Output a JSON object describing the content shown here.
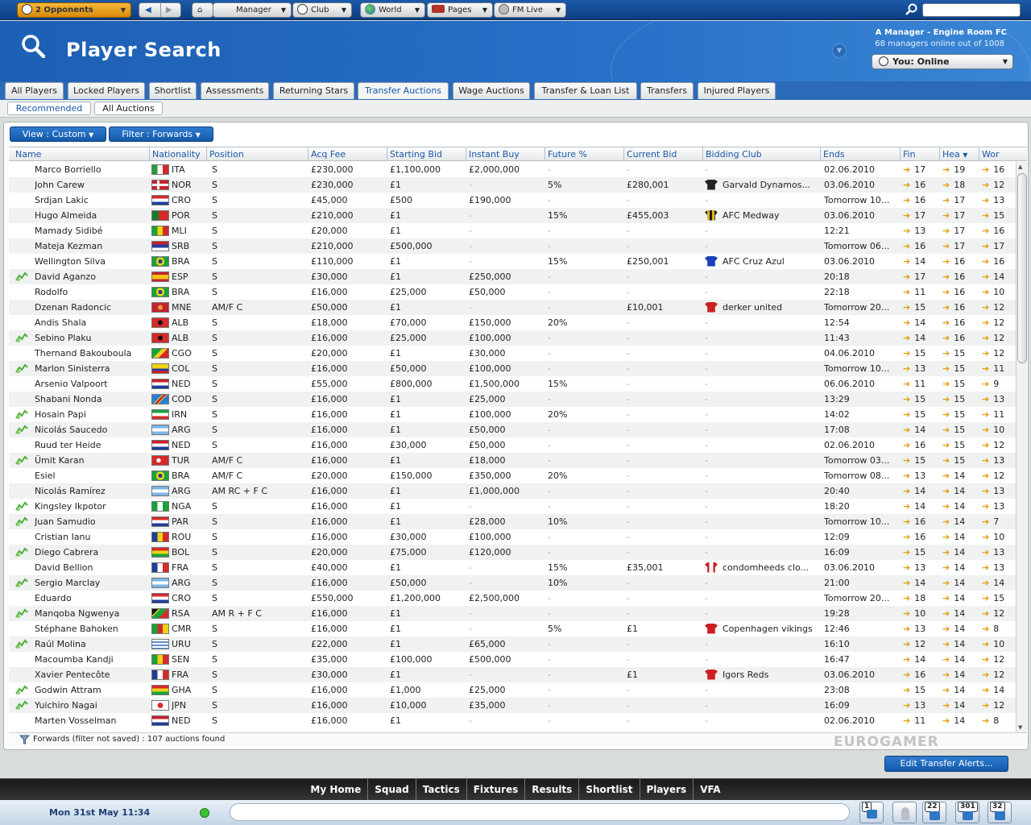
{
  "topbar": {
    "opponents": "2 Opponents",
    "manager": "Manager",
    "club": "Club",
    "world": "World",
    "pages": "Pages",
    "fm_live": "FM Live"
  },
  "header": {
    "title": "Player Search",
    "manager_name": "A Manager - Engine Room FC",
    "managers_online": "68 managers online out of 1008",
    "status": "You: Online"
  },
  "tabs": [
    "All Players",
    "Locked Players",
    "Shortlist",
    "Assessments",
    "Returning Stars",
    "Transfer Auctions",
    "Wage Auctions",
    "Transfer & Loan List",
    "Transfers",
    "Injured Players"
  ],
  "subtabs": [
    "Recommended",
    "All Auctions"
  ],
  "view_button": "View : Custom",
  "filter_button": "Filter : Forwards",
  "columns": [
    "Name",
    "Nationality",
    "Position",
    "Acq Fee",
    "Starting Bid",
    "Instant Buy",
    "Future %",
    "Current Bid",
    "Bidding Club",
    "Ends",
    "Fin",
    "Hea",
    "Wor"
  ],
  "players": [
    {
      "name": "Marco Borriello",
      "nat": "ITA",
      "pos": "S",
      "acq": "£230,000",
      "start": "£1,100,000",
      "buy": "£2,000,000",
      "fut": "-",
      "bid": "-",
      "club": "-",
      "ends": "02.06.2010",
      "fin": "17",
      "hea": "19",
      "wor": "16",
      "star": false,
      "flag": "ita",
      "shirt": ""
    },
    {
      "name": "John Carew",
      "nat": "NOR",
      "pos": "S",
      "acq": "£230,000",
      "start": "£1",
      "buy": "-",
      "fut": "5%",
      "bid": "£280,001",
      "club": "Garvald Dynamos...",
      "ends": "03.06.2010",
      "fin": "16",
      "hea": "18",
      "wor": "12",
      "star": false,
      "flag": "nor",
      "shirt": "black"
    },
    {
      "name": "Srdjan Lakic",
      "nat": "CRO",
      "pos": "S",
      "acq": "£45,000",
      "start": "£500",
      "buy": "£190,000",
      "fut": "-",
      "bid": "-",
      "club": "-",
      "ends": "Tomorrow 10...",
      "fin": "16",
      "hea": "17",
      "wor": "13",
      "star": false,
      "flag": "cro",
      "shirt": ""
    },
    {
      "name": "Hugo Almeida",
      "nat": "POR",
      "pos": "S",
      "acq": "£210,000",
      "start": "£1",
      "buy": "-",
      "fut": "15%",
      "bid": "£455,003",
      "club": "AFC Medway",
      "ends": "03.06.2010",
      "fin": "17",
      "hea": "17",
      "wor": "15",
      "star": false,
      "flag": "por",
      "shirt": "stripe"
    },
    {
      "name": "Mamady Sidibé",
      "nat": "MLI",
      "pos": "S",
      "acq": "£20,000",
      "start": "£1",
      "buy": "-",
      "fut": "-",
      "bid": "-",
      "club": "-",
      "ends": "12:21",
      "fin": "13",
      "hea": "17",
      "wor": "16",
      "star": false,
      "flag": "mli",
      "shirt": ""
    },
    {
      "name": "Mateja Kezman",
      "nat": "SRB",
      "pos": "S",
      "acq": "£210,000",
      "start": "£500,000",
      "buy": "-",
      "fut": "-",
      "bid": "-",
      "club": "-",
      "ends": "Tomorrow 06...",
      "fin": "16",
      "hea": "17",
      "wor": "17",
      "star": false,
      "flag": "srb",
      "shirt": ""
    },
    {
      "name": "Wellington Silva",
      "nat": "BRA",
      "pos": "S",
      "acq": "£110,000",
      "start": "£1",
      "buy": "-",
      "fut": "15%",
      "bid": "£250,001",
      "club": "AFC Cruz Azul",
      "ends": "03.06.2010",
      "fin": "14",
      "hea": "16",
      "wor": "16",
      "star": false,
      "flag": "bra",
      "shirt": "blue"
    },
    {
      "name": "David Aganzo",
      "nat": "ESP",
      "pos": "S",
      "acq": "£30,000",
      "start": "£1",
      "buy": "£250,000",
      "fut": "-",
      "bid": "-",
      "club": "-",
      "ends": "20:18",
      "fin": "17",
      "hea": "16",
      "wor": "14",
      "star": true,
      "flag": "esp",
      "shirt": ""
    },
    {
      "name": "Rodolfo",
      "nat": "BRA",
      "pos": "S",
      "acq": "£16,000",
      "start": "£25,000",
      "buy": "£50,000",
      "fut": "-",
      "bid": "-",
      "club": "-",
      "ends": "22:18",
      "fin": "11",
      "hea": "16",
      "wor": "10",
      "star": false,
      "flag": "bra",
      "shirt": ""
    },
    {
      "name": "Dzenan Radoncic",
      "nat": "MNE",
      "pos": "AM/F C",
      "acq": "£50,000",
      "start": "£1",
      "buy": "-",
      "fut": "-",
      "bid": "£10,001",
      "club": "derker united",
      "ends": "Tomorrow 20...",
      "fin": "15",
      "hea": "16",
      "wor": "12",
      "star": false,
      "flag": "mne",
      "shirt": "red"
    },
    {
      "name": "Andis Shala",
      "nat": "ALB",
      "pos": "S",
      "acq": "£18,000",
      "start": "£70,000",
      "buy": "£150,000",
      "fut": "20%",
      "bid": "-",
      "club": "-",
      "ends": "12:54",
      "fin": "14",
      "hea": "16",
      "wor": "12",
      "star": false,
      "flag": "alb",
      "shirt": ""
    },
    {
      "name": "Sebino Plaku",
      "nat": "ALB",
      "pos": "S",
      "acq": "£16,000",
      "start": "£25,000",
      "buy": "£100,000",
      "fut": "-",
      "bid": "-",
      "club": "-",
      "ends": "11:43",
      "fin": "14",
      "hea": "16",
      "wor": "12",
      "star": true,
      "flag": "alb",
      "shirt": ""
    },
    {
      "name": "Thernand Bakouboula",
      "nat": "CGO",
      "pos": "S",
      "acq": "£20,000",
      "start": "£1",
      "buy": "£30,000",
      "fut": "-",
      "bid": "-",
      "club": "-",
      "ends": "04.06.2010",
      "fin": "15",
      "hea": "15",
      "wor": "12",
      "star": false,
      "flag": "cgo",
      "shirt": ""
    },
    {
      "name": "Marlon Sinisterra",
      "nat": "COL",
      "pos": "S",
      "acq": "£16,000",
      "start": "£50,000",
      "buy": "£100,000",
      "fut": "-",
      "bid": "-",
      "club": "-",
      "ends": "Tomorrow 10...",
      "fin": "13",
      "hea": "15",
      "wor": "11",
      "star": true,
      "flag": "col",
      "shirt": ""
    },
    {
      "name": "Arsenio Valpoort",
      "nat": "NED",
      "pos": "S",
      "acq": "£55,000",
      "start": "£800,000",
      "buy": "£1,500,000",
      "fut": "15%",
      "bid": "-",
      "club": "-",
      "ends": "06.06.2010",
      "fin": "11",
      "hea": "15",
      "wor": "9",
      "star": false,
      "flag": "ned",
      "shirt": ""
    },
    {
      "name": "Shabani Nonda",
      "nat": "COD",
      "pos": "S",
      "acq": "£16,000",
      "start": "£1",
      "buy": "£25,000",
      "fut": "-",
      "bid": "-",
      "club": "-",
      "ends": "13:29",
      "fin": "15",
      "hea": "15",
      "wor": "13",
      "star": false,
      "flag": "cod",
      "shirt": ""
    },
    {
      "name": "Hosain Papi",
      "nat": "IRN",
      "pos": "S",
      "acq": "£16,000",
      "start": "£1",
      "buy": "£100,000",
      "fut": "20%",
      "bid": "-",
      "club": "-",
      "ends": "14:02",
      "fin": "15",
      "hea": "15",
      "wor": "11",
      "star": true,
      "flag": "irn",
      "shirt": ""
    },
    {
      "name": "Nicolás Saucedo",
      "nat": "ARG",
      "pos": "S",
      "acq": "£16,000",
      "start": "£1",
      "buy": "£50,000",
      "fut": "-",
      "bid": "-",
      "club": "-",
      "ends": "17:08",
      "fin": "14",
      "hea": "15",
      "wor": "10",
      "star": true,
      "flag": "arg",
      "shirt": ""
    },
    {
      "name": "Ruud ter Heide",
      "nat": "NED",
      "pos": "S",
      "acq": "£16,000",
      "start": "£30,000",
      "buy": "£50,000",
      "fut": "-",
      "bid": "-",
      "club": "-",
      "ends": "02.06.2010",
      "fin": "16",
      "hea": "15",
      "wor": "12",
      "star": false,
      "flag": "ned",
      "shirt": ""
    },
    {
      "name": "Ümit Karan",
      "nat": "TUR",
      "pos": "AM/F C",
      "acq": "£16,000",
      "start": "£1",
      "buy": "£18,000",
      "fut": "-",
      "bid": "-",
      "club": "-",
      "ends": "Tomorrow 03...",
      "fin": "15",
      "hea": "15",
      "wor": "13",
      "star": true,
      "flag": "tur",
      "shirt": ""
    },
    {
      "name": "Esiel",
      "nat": "BRA",
      "pos": "AM/F C",
      "acq": "£20,000",
      "start": "£150,000",
      "buy": "£350,000",
      "fut": "20%",
      "bid": "-",
      "club": "-",
      "ends": "Tomorrow 08...",
      "fin": "13",
      "hea": "14",
      "wor": "12",
      "star": false,
      "flag": "bra",
      "shirt": ""
    },
    {
      "name": "Nicolás Ramírez",
      "nat": "ARG",
      "pos": "AM RC + F C",
      "acq": "£16,000",
      "start": "£1",
      "buy": "£1,000,000",
      "fut": "-",
      "bid": "-",
      "club": "-",
      "ends": "20:40",
      "fin": "14",
      "hea": "14",
      "wor": "13",
      "star": false,
      "flag": "arg",
      "shirt": ""
    },
    {
      "name": "Kingsley Ikpotor",
      "nat": "NGA",
      "pos": "S",
      "acq": "£16,000",
      "start": "£1",
      "buy": "-",
      "fut": "-",
      "bid": "-",
      "club": "-",
      "ends": "18:20",
      "fin": "14",
      "hea": "14",
      "wor": "13",
      "star": true,
      "flag": "nga",
      "shirt": ""
    },
    {
      "name": "Juan Samudio",
      "nat": "PAR",
      "pos": "S",
      "acq": "£16,000",
      "start": "£1",
      "buy": "£28,000",
      "fut": "10%",
      "bid": "-",
      "club": "-",
      "ends": "Tomorrow 10...",
      "fin": "16",
      "hea": "14",
      "wor": "7",
      "star": true,
      "flag": "par",
      "shirt": ""
    },
    {
      "name": "Cristian Ianu",
      "nat": "ROU",
      "pos": "S",
      "acq": "£16,000",
      "start": "£30,000",
      "buy": "£100,000",
      "fut": "-",
      "bid": "-",
      "club": "-",
      "ends": "12:09",
      "fin": "16",
      "hea": "14",
      "wor": "10",
      "star": false,
      "flag": "rou",
      "shirt": ""
    },
    {
      "name": "Diego Cabrera",
      "nat": "BOL",
      "pos": "S",
      "acq": "£20,000",
      "start": "£75,000",
      "buy": "£120,000",
      "fut": "-",
      "bid": "-",
      "club": "-",
      "ends": "16:09",
      "fin": "15",
      "hea": "14",
      "wor": "13",
      "star": true,
      "flag": "bol",
      "shirt": ""
    },
    {
      "name": "David Bellion",
      "nat": "FRA",
      "pos": "S",
      "acq": "£40,000",
      "start": "£1",
      "buy": "-",
      "fut": "15%",
      "bid": "£35,001",
      "club": "condomheeds clo...",
      "ends": "03.06.2010",
      "fin": "13",
      "hea": "14",
      "wor": "13",
      "star": false,
      "flag": "fra",
      "shirt": "redwhite"
    },
    {
      "name": "Sergio Marclay",
      "nat": "ARG",
      "pos": "S",
      "acq": "£16,000",
      "start": "£50,000",
      "buy": "-",
      "fut": "10%",
      "bid": "-",
      "club": "-",
      "ends": "21:00",
      "fin": "14",
      "hea": "14",
      "wor": "14",
      "star": true,
      "flag": "arg",
      "shirt": ""
    },
    {
      "name": "Eduardo",
      "nat": "CRO",
      "pos": "S",
      "acq": "£550,000",
      "start": "£1,200,000",
      "buy": "£2,500,000",
      "fut": "-",
      "bid": "-",
      "club": "-",
      "ends": "Tomorrow 20...",
      "fin": "18",
      "hea": "14",
      "wor": "15",
      "star": false,
      "flag": "cro",
      "shirt": ""
    },
    {
      "name": "Manqoba Ngwenya",
      "nat": "RSA",
      "pos": "AM R + F C",
      "acq": "£16,000",
      "start": "£1",
      "buy": "-",
      "fut": "-",
      "bid": "-",
      "club": "-",
      "ends": "19:28",
      "fin": "10",
      "hea": "14",
      "wor": "12",
      "star": true,
      "flag": "rsa",
      "shirt": ""
    },
    {
      "name": "Stéphane Bahoken",
      "nat": "CMR",
      "pos": "S",
      "acq": "£16,000",
      "start": "£1",
      "buy": "-",
      "fut": "5%",
      "bid": "£1",
      "club": "Copenhagen vikings",
      "ends": "12:46",
      "fin": "13",
      "hea": "14",
      "wor": "8",
      "star": false,
      "flag": "cmr",
      "shirt": "red"
    },
    {
      "name": "Raúl Molina",
      "nat": "URU",
      "pos": "S",
      "acq": "£22,000",
      "start": "£1",
      "buy": "£65,000",
      "fut": "-",
      "bid": "-",
      "club": "-",
      "ends": "16:10",
      "fin": "12",
      "hea": "14",
      "wor": "10",
      "star": true,
      "flag": "uru",
      "shirt": ""
    },
    {
      "name": "Macoumba Kandji",
      "nat": "SEN",
      "pos": "S",
      "acq": "£35,000",
      "start": "£100,000",
      "buy": "£500,000",
      "fut": "-",
      "bid": "-",
      "club": "-",
      "ends": "16:47",
      "fin": "14",
      "hea": "14",
      "wor": "12",
      "star": false,
      "flag": "sen",
      "shirt": ""
    },
    {
      "name": "Xavier Pentecôte",
      "nat": "FRA",
      "pos": "S",
      "acq": "£30,000",
      "start": "£1",
      "buy": "-",
      "fut": "-",
      "bid": "£1",
      "club": "Igors Reds",
      "ends": "03.06.2010",
      "fin": "16",
      "hea": "14",
      "wor": "12",
      "star": false,
      "flag": "fra",
      "shirt": "red"
    },
    {
      "name": "Godwin Attram",
      "nat": "GHA",
      "pos": "S",
      "acq": "£16,000",
      "start": "£1,000",
      "buy": "£25,000",
      "fut": "-",
      "bid": "-",
      "club": "-",
      "ends": "23:08",
      "fin": "15",
      "hea": "14",
      "wor": "14",
      "star": true,
      "flag": "gha",
      "shirt": ""
    },
    {
      "name": "Yuichiro Nagai",
      "nat": "JPN",
      "pos": "S",
      "acq": "£16,000",
      "start": "£10,000",
      "buy": "£35,000",
      "fut": "-",
      "bid": "-",
      "club": "-",
      "ends": "16:09",
      "fin": "13",
      "hea": "14",
      "wor": "12",
      "star": true,
      "flag": "jpn",
      "shirt": ""
    },
    {
      "name": "Marten Vosselman",
      "nat": "NED",
      "pos": "S",
      "acq": "£16,000",
      "start": "£1",
      "buy": "-",
      "fut": "-",
      "bid": "-",
      "club": "-",
      "ends": "02.06.2010",
      "fin": "11",
      "hea": "14",
      "wor": "8",
      "star": false,
      "flag": "ned",
      "shirt": ""
    }
  ],
  "status_line": "Forwards (filter not saved) : 107 auctions found",
  "edit_alerts": "Edit Transfer Alerts...",
  "bottom_nav": [
    "My Home",
    "Squad",
    "Tactics",
    "Fixtures",
    "Results",
    "Shortlist",
    "Players",
    "VFA"
  ],
  "footer": {
    "date": "Mon 31st May 11:34",
    "badges": [
      "1",
      "22",
      "301",
      "32"
    ]
  },
  "watermark": "EUROGAMER",
  "colors": {
    "accent": "#1b58a6",
    "header_blue": "#2870c8",
    "arrow": "#e79a0c",
    "online": "#3cc234"
  }
}
